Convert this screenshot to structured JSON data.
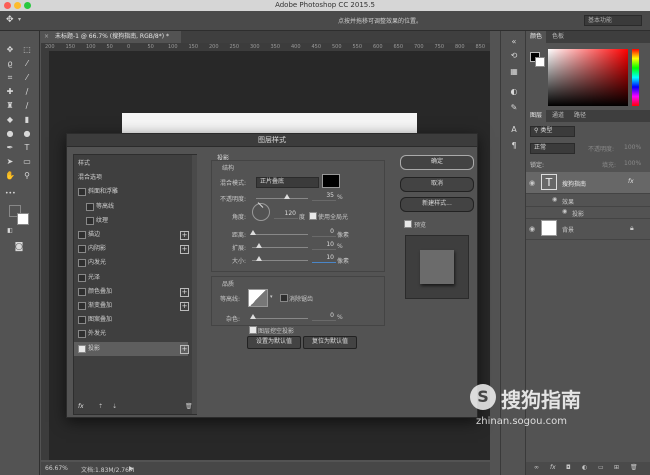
{
  "app": {
    "title": "Adobe Photoshop CC 2015.5"
  },
  "options_bar": {
    "hint": "点按并拖移可调整效果的位置。",
    "workspace": "基本功能"
  },
  "document": {
    "tab": "未标题-1 @ 66.7% (搜狗指南, RGB/8*) *",
    "ruler_ticks": [
      "200",
      "150",
      "100",
      "50",
      "0",
      "50",
      "100",
      "150",
      "200",
      "250",
      "300",
      "350",
      "400",
      "450",
      "500",
      "550",
      "600",
      "650",
      "700",
      "750",
      "800",
      "850"
    ]
  },
  "status": {
    "zoom": "66.67%",
    "doc": "文档:1.83M/2.76M"
  },
  "color_panel": {
    "tabs": [
      "颜色",
      "色板"
    ],
    "foreground": "#000000",
    "background": "#ffffff"
  },
  "layers_panel": {
    "tabs": [
      "图层",
      "通道",
      "路径"
    ],
    "kind": "类型",
    "blend": "正常",
    "opacity_label": "不透明度:",
    "opacity": "100%",
    "lock_label": "锁定:",
    "fill_label": "填充:",
    "fill": "100%",
    "layers": [
      {
        "name": "搜狗指南",
        "type": "text",
        "fx": "fx"
      },
      {
        "name": "效果",
        "type": "effects"
      },
      {
        "name": "投影",
        "type": "effect"
      },
      {
        "name": "背景",
        "type": "background"
      }
    ]
  },
  "dialog": {
    "title": "图层样式",
    "list": [
      {
        "label": "样式",
        "checkbox": false,
        "plus": false,
        "indent": 0
      },
      {
        "label": "混合选项",
        "checkbox": false,
        "plus": false,
        "indent": 0
      },
      {
        "label": "斜面和浮雕",
        "checkbox": true,
        "checked": false,
        "plus": false,
        "indent": 0
      },
      {
        "label": "等高线",
        "checkbox": true,
        "checked": false,
        "plus": false,
        "indent": 1
      },
      {
        "label": "纹理",
        "checkbox": true,
        "checked": false,
        "plus": false,
        "indent": 1
      },
      {
        "label": "描边",
        "checkbox": true,
        "checked": false,
        "plus": true,
        "indent": 0
      },
      {
        "label": "内阴影",
        "checkbox": true,
        "checked": false,
        "plus": true,
        "indent": 0
      },
      {
        "label": "内发光",
        "checkbox": true,
        "checked": false,
        "plus": false,
        "indent": 0
      },
      {
        "label": "光泽",
        "checkbox": true,
        "checked": false,
        "plus": false,
        "indent": 0
      },
      {
        "label": "颜色叠加",
        "checkbox": true,
        "checked": false,
        "plus": true,
        "indent": 0
      },
      {
        "label": "渐变叠加",
        "checkbox": true,
        "checked": false,
        "plus": true,
        "indent": 0
      },
      {
        "label": "图案叠加",
        "checkbox": true,
        "checked": false,
        "plus": false,
        "indent": 0
      },
      {
        "label": "外发光",
        "checkbox": true,
        "checked": false,
        "plus": false,
        "indent": 0
      },
      {
        "label": "投影",
        "checkbox": true,
        "checked": true,
        "plus": true,
        "indent": 0,
        "selected": true
      }
    ],
    "list_footer": {
      "fx": "fx"
    },
    "section": "投影",
    "structure": {
      "title": "结构",
      "blend_mode_label": "混合模式:",
      "blend_mode": "正片叠底",
      "shadow_color": "#000000",
      "opacity_label": "不透明度:",
      "opacity": "35",
      "angle_label": "角度:",
      "angle": "120",
      "angle_unit": "度",
      "global_light_label": "使用全局光",
      "global_light": true,
      "distance_label": "距离:",
      "distance": "0",
      "spread_label": "扩展:",
      "spread": "10",
      "size_label": "大小:",
      "size": "10",
      "px": "像素",
      "pct": "%"
    },
    "quality": {
      "title": "品质",
      "contour_label": "等高线:",
      "antialias_label": "消除锯齿",
      "noise_label": "杂色:",
      "noise": "0",
      "pct": "%"
    },
    "knockout_label": "图层挖空投影",
    "set_default": "设置为默认值",
    "reset_default": "复位为默认值",
    "buttons": {
      "ok": "确定",
      "cancel": "取消",
      "new_style": "新建样式...",
      "preview": "预览"
    }
  },
  "watermark": {
    "text": "搜狗指南",
    "url": "zhinan.sogou.com"
  }
}
